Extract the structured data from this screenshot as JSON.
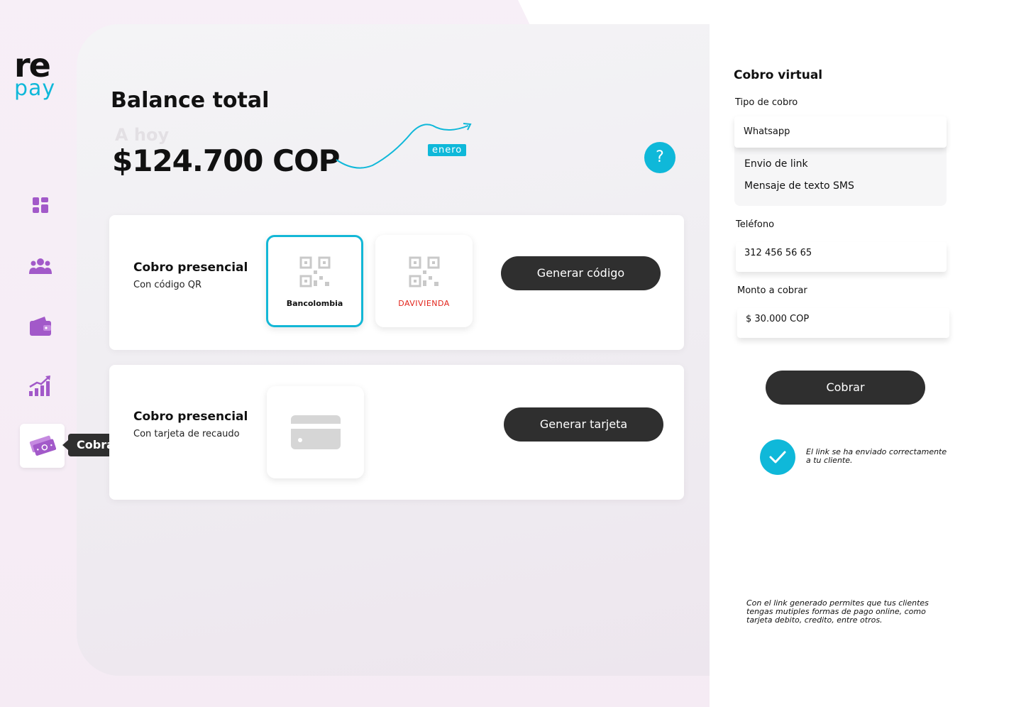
{
  "brand": {
    "logo_top": "re",
    "logo_bottom": "pay",
    "accent": "#0fb8d9",
    "nav_color": "#a259c9"
  },
  "sidebar": {
    "items": [
      {
        "icon": "dashboard-icon"
      },
      {
        "icon": "users-icon"
      },
      {
        "icon": "wallet-icon"
      },
      {
        "icon": "stats-icon"
      },
      {
        "icon": "cash-icon",
        "active": true
      }
    ],
    "tooltip": "Cobrar"
  },
  "balance": {
    "title": "Balance total",
    "period_label": "A hoy",
    "amount": "$124.700 COP",
    "month_badge": "enero",
    "help_label": "?"
  },
  "cards": [
    {
      "title": "Cobro presencial",
      "subtitle": "Con código QR",
      "tiles": [
        "Bancolombia",
        "DAVIVIENDA"
      ],
      "button": "Generar código"
    },
    {
      "title": "Cobro presencial",
      "subtitle": "Con tarjeta de recaudo",
      "button": "Generar tarjeta"
    }
  ],
  "virtual": {
    "title": "Cobro virtual",
    "type_label": "Tipo de cobro",
    "type_selected": "Whatsapp",
    "type_options": [
      "Envio de link",
      "Mensaje de texto SMS"
    ],
    "phone_label": "Teléfono",
    "phone_value": "312 456 56 65",
    "amount_label": "Monto a cobrar",
    "amount_value": "$ 30.000 COP",
    "submit": "Cobrar",
    "success_message": "El link se ha enviado correctamente a tu cliente.",
    "footer_note": "Con el link generado permites que tus clientes tengas mutiples formas de pago online, como tarjeta debito, credito, entre otros."
  }
}
